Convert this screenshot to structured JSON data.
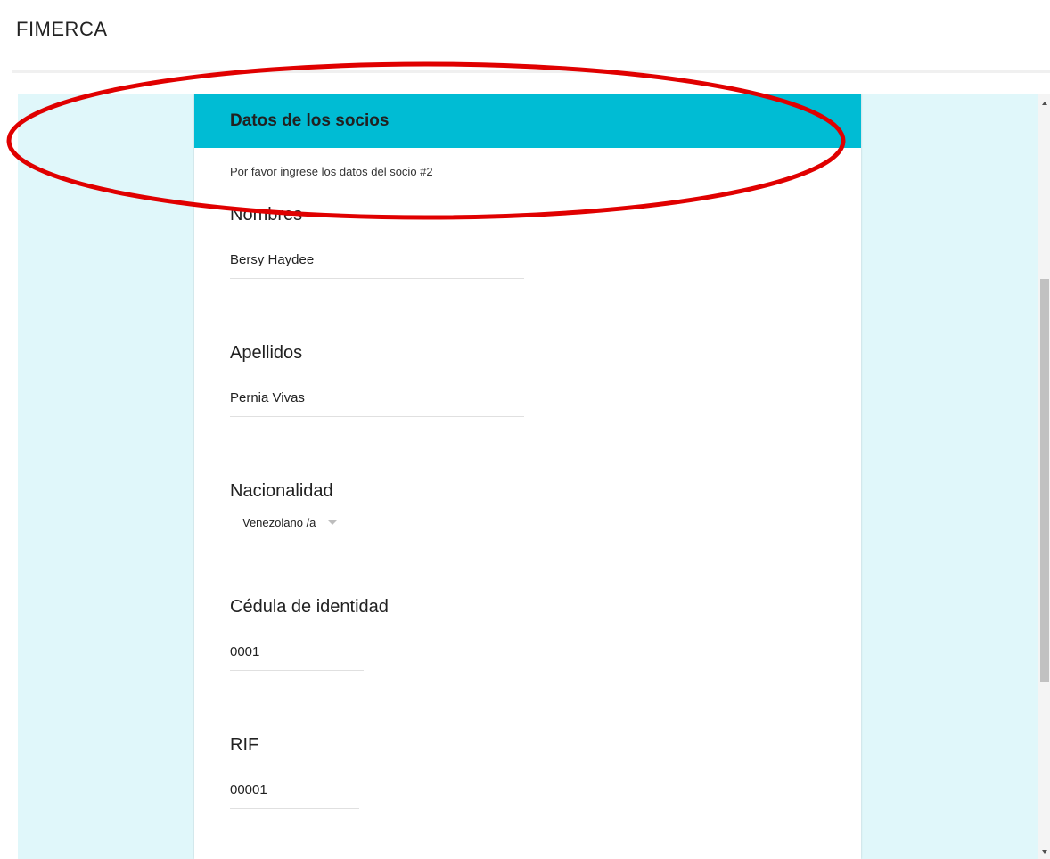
{
  "app": {
    "title": "FIMERCA"
  },
  "form": {
    "header_title": "Datos de los socios",
    "description": "Por favor ingrese los datos del socio #2",
    "fields": {
      "nombres": {
        "label": "Nombres",
        "value": "Bersy Haydee"
      },
      "apellidos": {
        "label": "Apellidos",
        "value": "Pernia Vivas"
      },
      "nacionalidad": {
        "label": "Nacionalidad",
        "selected": "Venezolano /a"
      },
      "cedula": {
        "label": "Cédula de identidad",
        "value": "0001"
      },
      "rif": {
        "label": "RIF",
        "value": "00001"
      }
    }
  },
  "colors": {
    "header": "#00bcd4",
    "background": "#e0f7fa",
    "annotation": "#e00000"
  },
  "icons": {
    "select_caret": "caret-down-icon",
    "scroll_up": "scroll-up-arrow-icon",
    "scroll_down": "scroll-down-arrow-icon"
  }
}
